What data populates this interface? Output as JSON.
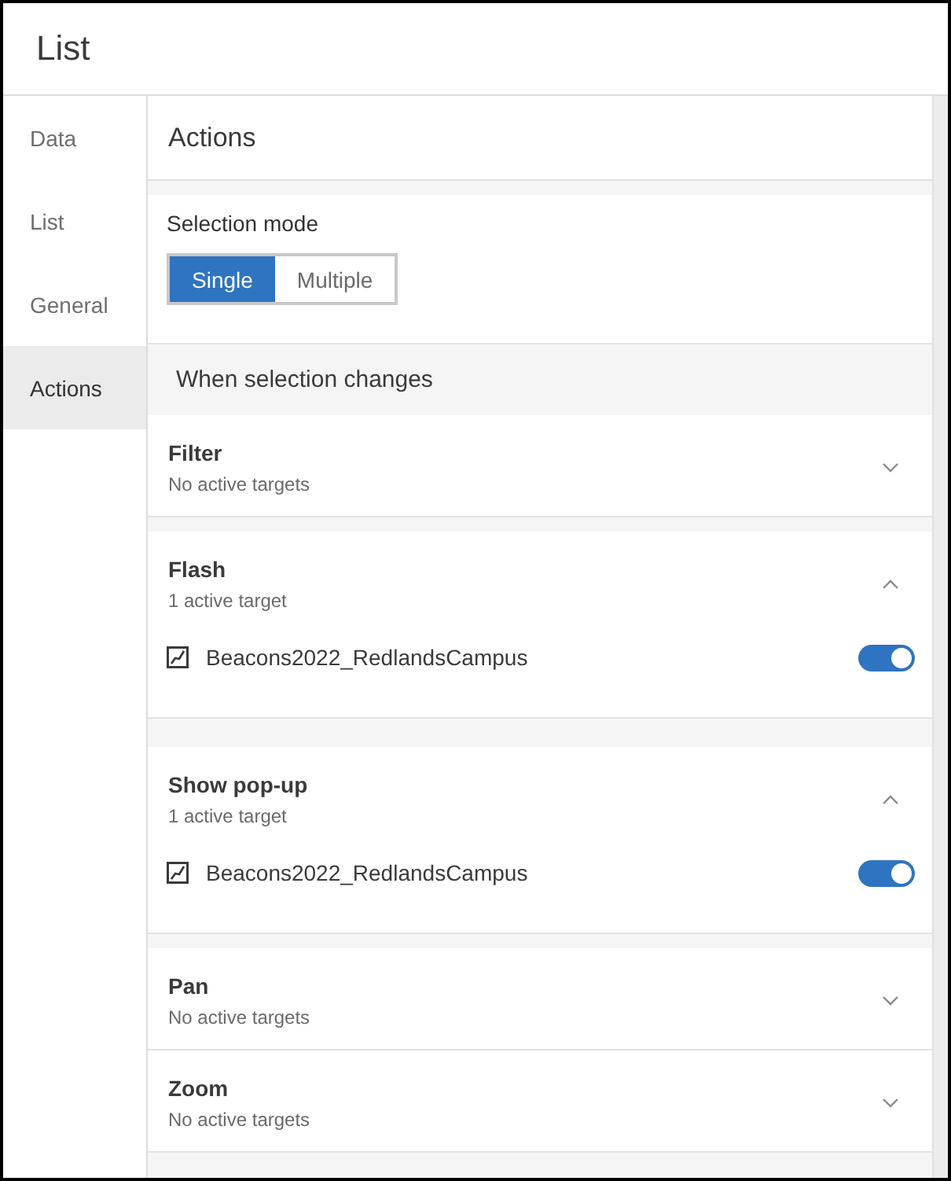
{
  "panel": {
    "title": "List"
  },
  "sidebar": {
    "items": [
      {
        "label": "Data",
        "selected": false
      },
      {
        "label": "List",
        "selected": false
      },
      {
        "label": "General",
        "selected": false
      },
      {
        "label": "Actions",
        "selected": true
      }
    ]
  },
  "content": {
    "header": "Actions",
    "selection_mode": {
      "label": "Selection mode",
      "options": [
        {
          "label": "Single",
          "selected": true
        },
        {
          "label": "Multiple",
          "selected": false
        }
      ]
    },
    "section_title": "When selection changes",
    "actions": [
      {
        "title": "Filter",
        "subtitle": "No active targets",
        "expanded": false
      },
      {
        "title": "Flash",
        "subtitle": "1 active target",
        "expanded": true,
        "targets": [
          {
            "name": "Beacons2022_RedlandsCampus",
            "on": true
          }
        ]
      },
      {
        "title": "Show pop-up",
        "subtitle": "1 active target",
        "expanded": true,
        "targets": [
          {
            "name": "Beacons2022_RedlandsCampus",
            "on": true
          }
        ]
      },
      {
        "title": "Pan",
        "subtitle": "No active targets",
        "expanded": false
      },
      {
        "title": "Zoom",
        "subtitle": "No active targets",
        "expanded": false
      }
    ]
  }
}
